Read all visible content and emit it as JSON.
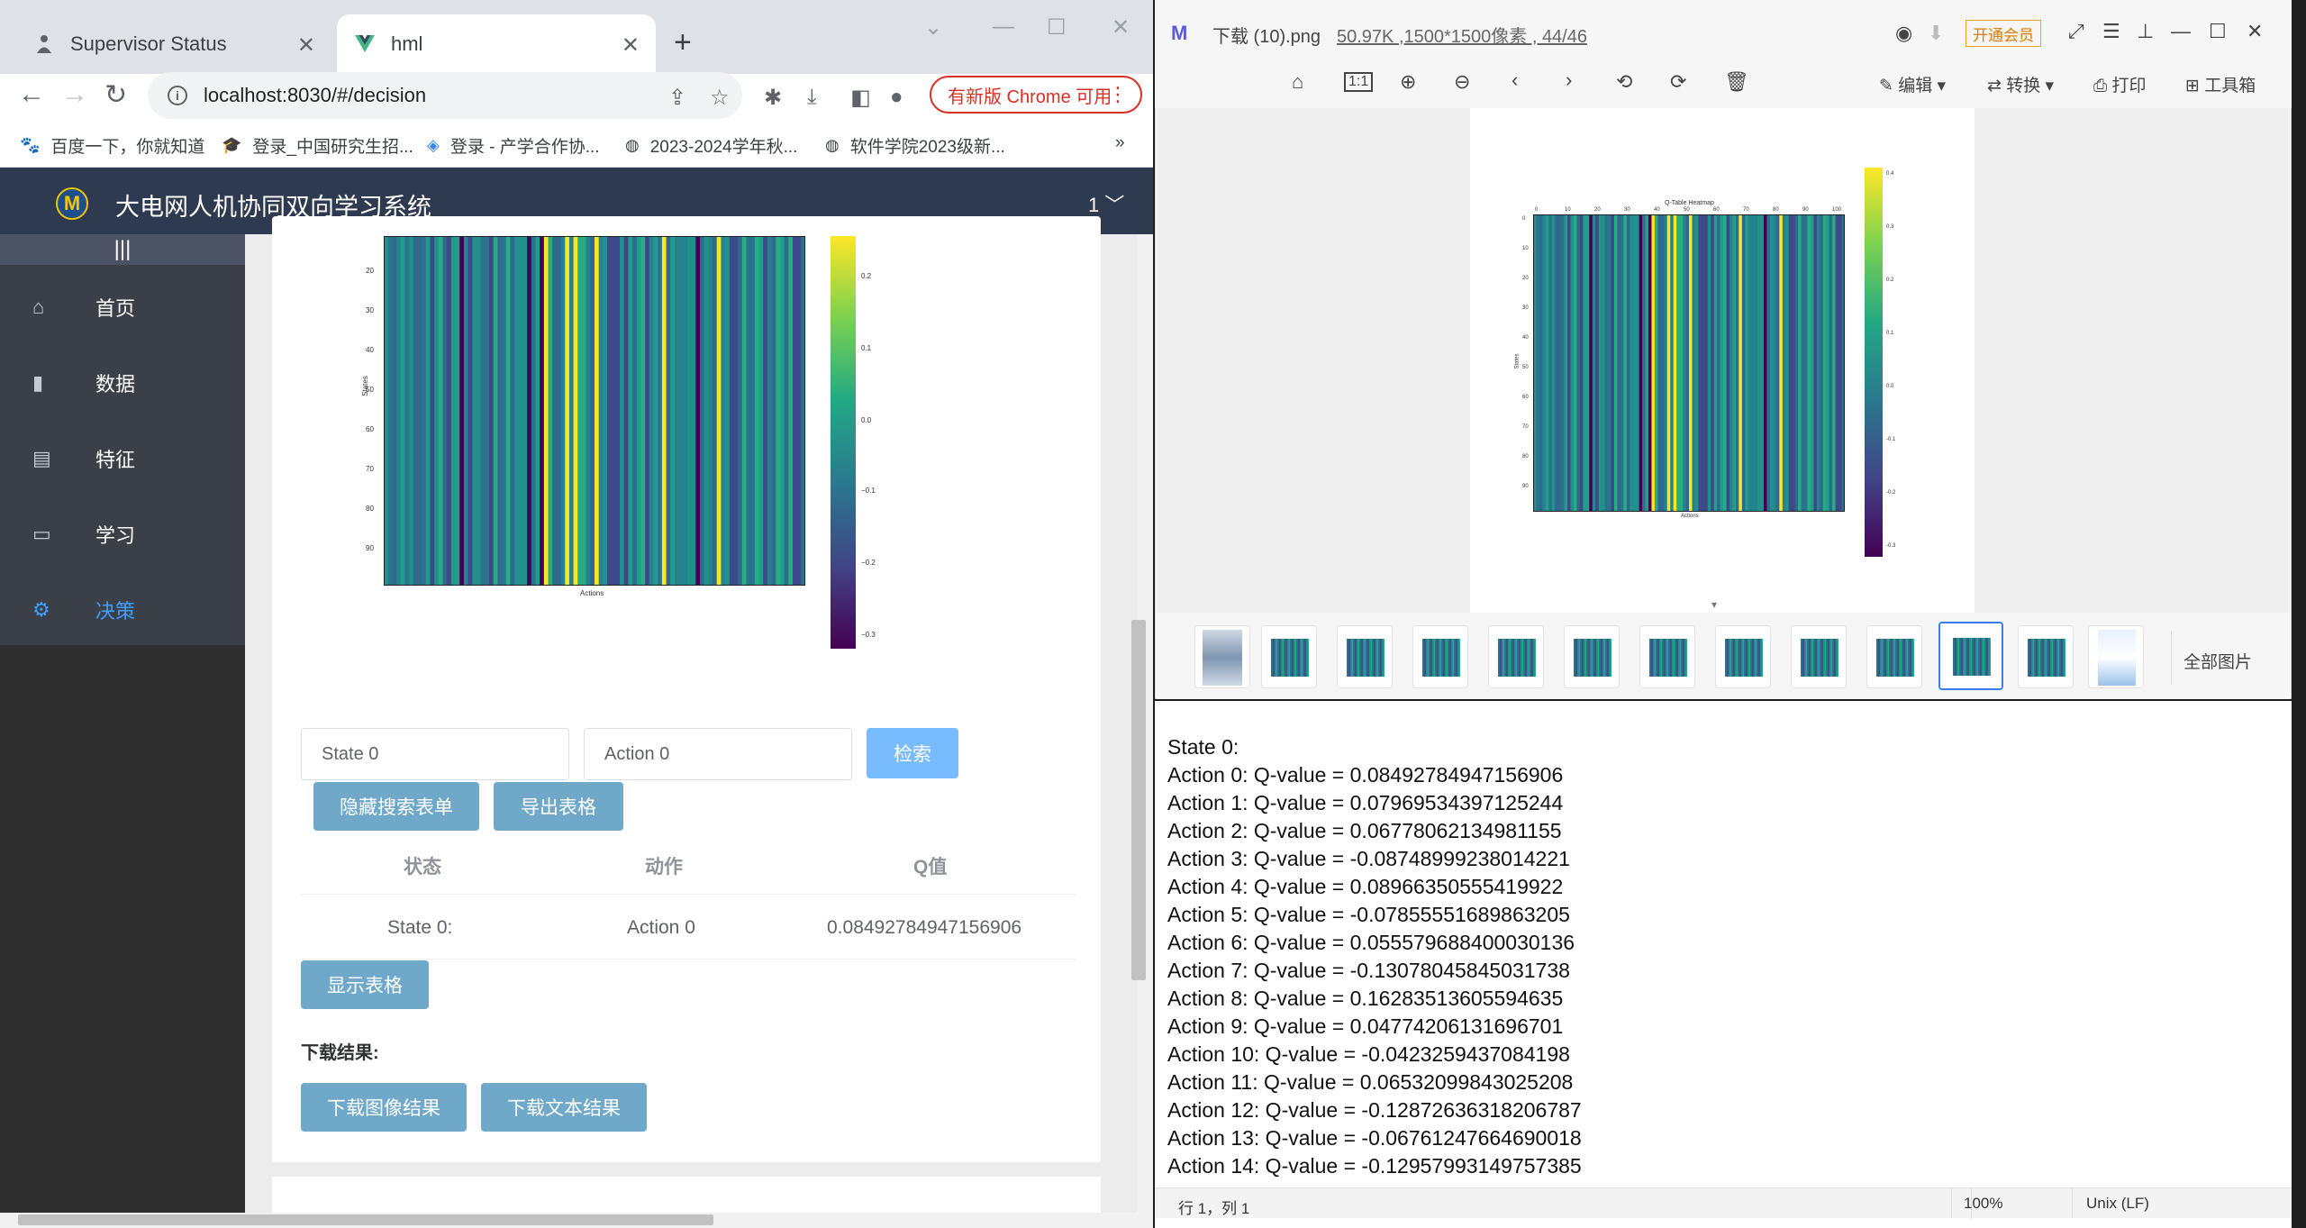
{
  "browser": {
    "tabs": [
      {
        "title": "Supervisor Status"
      },
      {
        "title": "hml"
      }
    ],
    "url": "localhost:8030/#/decision",
    "update_button": "有新版 Chrome 可用",
    "bookmarks": [
      "百度一下，你就知道",
      "登录_中国研究生招...",
      "登录 - 产学合作协...",
      "2023-2024学年秋...",
      "软件学院2023级新..."
    ],
    "bookmarks_more": "»"
  },
  "app": {
    "title": "大电网人机协同双向学习系统",
    "user_menu": "1",
    "sidebar_toggle": "|||",
    "sidebar": [
      {
        "label": "首页",
        "icon": "home-icon"
      },
      {
        "label": "数据",
        "icon": "bar-chart-icon"
      },
      {
        "label": "特征",
        "icon": "book-icon"
      },
      {
        "label": "学习",
        "icon": "monitor-icon"
      },
      {
        "label": "决策",
        "icon": "gear-icon",
        "active": true
      }
    ],
    "heatmap": {
      "y_ticks": [
        "20",
        "30",
        "40",
        "50",
        "60",
        "70",
        "80",
        "90"
      ],
      "ylabel": "States",
      "xlabel": "Actions",
      "colorbar_ticks": [
        "0.2",
        "0.1",
        "0.0",
        "−0.1",
        "−0.2",
        "−0.3"
      ]
    },
    "search": {
      "state_value": "State 0",
      "action_value": "Action 0",
      "search_button": "检索",
      "hide_button": "隐藏搜索表单",
      "export_button": "导出表格"
    },
    "table": {
      "headers": [
        "状态",
        "动作",
        "Q值"
      ],
      "rows": [
        {
          "state": "State 0:",
          "action": "Action 0",
          "q": "0.08492784947156906"
        }
      ]
    },
    "show_table_button": "显示表格",
    "download_label": "下载结果:",
    "download_image_button": "下载图像结果",
    "download_text_button": "下载文本结果"
  },
  "viewer": {
    "title": "下载 (10).png",
    "file_info": "50.97K ,1500*1500像素 , 44/46",
    "member_button": "开通会员",
    "toolbar": {
      "edit": "编辑",
      "convert": "转换",
      "print": "打印",
      "toolbox": "工具箱",
      "actual_size": "1:1"
    },
    "heatmap": {
      "title": "Q-Table Heatmap",
      "x_ticks": [
        "0",
        "10",
        "20",
        "30",
        "40",
        "50",
        "60",
        "70",
        "80",
        "90",
        "100"
      ],
      "y_ticks": [
        "0",
        "10",
        "20",
        "30",
        "40",
        "50",
        "60",
        "70",
        "80",
        "90"
      ],
      "colorbar_ticks": [
        "0.4",
        "0.3",
        "0.2",
        "0.1",
        "0.0",
        "-0.1",
        "-0.2",
        "-0.3"
      ],
      "xlabel": "Actions",
      "ylabel": "States"
    },
    "all_images": "全部图片"
  },
  "notepad": {
    "lines": [
      "State 0:",
      "Action 0: Q-value = 0.08492784947156906",
      "Action 1: Q-value = 0.07969534397125244",
      "Action 2: Q-value = 0.06778062134981155",
      "Action 3: Q-value = -0.08748999238014221",
      "Action 4: Q-value = 0.08966350555419922",
      "Action 5: Q-value = -0.07855551689863205",
      "Action 6: Q-value = 0.055579688400030136",
      "Action 7: Q-value = -0.13078045845031738",
      "Action 8: Q-value = 0.16283513605594635",
      "Action 9: Q-value = 0.04774206131696701",
      "Action 10: Q-value = -0.0423259437084198",
      "Action 11: Q-value = 0.06532099843025208",
      "Action 12: Q-value = -0.12872636318206787",
      "Action 13: Q-value = -0.06761247664690018",
      "Action 14: Q-value = -0.12957993149757385"
    ],
    "status": {
      "position": "行 1，列 1",
      "zoom": "100%",
      "eol": "Unix (LF)"
    }
  }
}
